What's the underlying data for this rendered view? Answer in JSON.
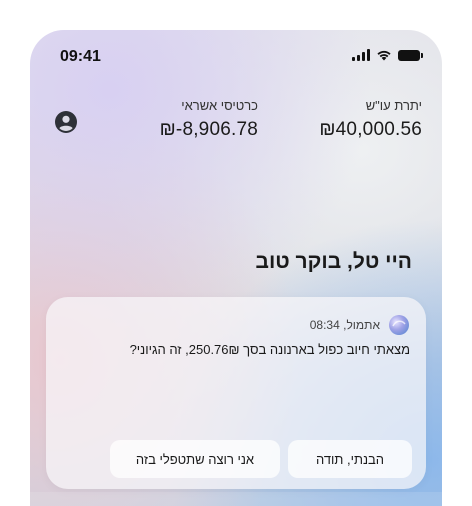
{
  "status_bar": {
    "time": "09:41"
  },
  "balances": {
    "account": {
      "label": "יתרת עו\"ש",
      "value": "₪40,000.56"
    },
    "credit": {
      "label": "כרטיסי אשראי",
      "value": "₪-8,906.78"
    }
  },
  "greeting": "היי טל, בוקר טוב",
  "message": {
    "timestamp": "אתמול, 08:34",
    "text": "מצאתי חיוב כפול בארנונה בסך 250.76₪, זה הגיוני?",
    "actions": {
      "acknowledge": "הבנתי, תודה",
      "handle": "אני רוצה שתטפלי בזה"
    }
  },
  "icons": {
    "avatar": "user-circle-icon",
    "assistant": "assistant-orb-icon",
    "signal": "cellular-signal-icon",
    "wifi": "wifi-icon",
    "battery": "battery-icon"
  }
}
